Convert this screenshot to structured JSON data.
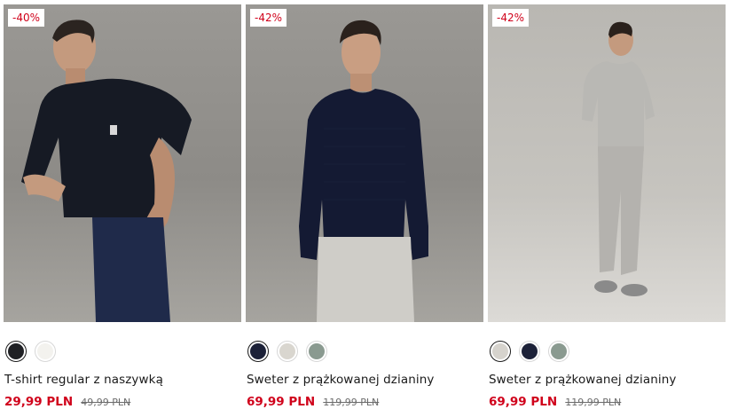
{
  "products": [
    {
      "discount": "-40%",
      "name": "T-shirt regular z naszywką",
      "price": "29,99 PLN",
      "old_price": "49,99 PLN",
      "swatches": [
        {
          "color": "#1f2024",
          "selected": true
        },
        {
          "color": "#f3f2ee",
          "selected": false
        }
      ]
    },
    {
      "discount": "-42%",
      "name": "Sweter z prążkowanej dzianiny",
      "price": "69,99 PLN",
      "old_price": "119,99 PLN",
      "swatches": [
        {
          "color": "#1c2138",
          "selected": true
        },
        {
          "color": "#d9d6cf",
          "selected": false
        },
        {
          "color": "#8a9a90",
          "selected": false
        }
      ]
    },
    {
      "discount": "-42%",
      "name": "Sweter z prążkowanej dzianiny",
      "price": "69,99 PLN",
      "old_price": "119,99 PLN",
      "swatches": [
        {
          "color": "#d6d3cd",
          "selected": true
        },
        {
          "color": "#1c2138",
          "selected": false
        },
        {
          "color": "#8a9a90",
          "selected": false
        }
      ]
    }
  ],
  "colors": {
    "sale_red": "#d0021b",
    "old_price_gray": "#6b6b6b"
  }
}
